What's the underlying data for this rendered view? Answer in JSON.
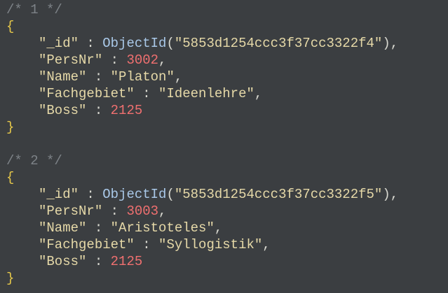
{
  "documents": [
    {
      "comment": "/* 1 */",
      "open": "{",
      "close": "}",
      "fields": [
        {
          "key": "\"_id\"",
          "sep": " : ",
          "func": "ObjectId",
          "func_open": "(",
          "value": "\"5853d1254ccc3f37cc3322f4\"",
          "func_close": ")",
          "type": "objectid",
          "comma": ","
        },
        {
          "key": "\"PersNr\"",
          "sep": " : ",
          "value": "3002",
          "type": "number",
          "comma": ","
        },
        {
          "key": "\"Name\"",
          "sep": " : ",
          "value": "\"Platon\"",
          "type": "string",
          "comma": ","
        },
        {
          "key": "\"Fachgebiet\"",
          "sep": " : ",
          "value": "\"Ideenlehre\"",
          "type": "string",
          "comma": ","
        },
        {
          "key": "\"Boss\"",
          "sep": " : ",
          "value": "2125",
          "type": "number",
          "comma": ""
        }
      ]
    },
    {
      "comment": "/* 2 */",
      "open": "{",
      "close": "}",
      "fields": [
        {
          "key": "\"_id\"",
          "sep": " : ",
          "func": "ObjectId",
          "func_open": "(",
          "value": "\"5853d1254ccc3f37cc3322f5\"",
          "func_close": ")",
          "type": "objectid",
          "comma": ","
        },
        {
          "key": "\"PersNr\"",
          "sep": " : ",
          "value": "3003",
          "type": "number",
          "comma": ","
        },
        {
          "key": "\"Name\"",
          "sep": " : ",
          "value": "\"Aristoteles\"",
          "type": "string",
          "comma": ","
        },
        {
          "key": "\"Fachgebiet\"",
          "sep": " : ",
          "value": "\"Syllogistik\"",
          "type": "string",
          "comma": ","
        },
        {
          "key": "\"Boss\"",
          "sep": " : ",
          "value": "2125",
          "type": "number",
          "comma": ""
        }
      ]
    }
  ],
  "colors": {
    "background": "#3b3e41",
    "comment": "#7d8287",
    "brace": "#e6c84a",
    "string": "#e6d9a8",
    "function": "#a9c8e8",
    "number": "#f07070"
  }
}
